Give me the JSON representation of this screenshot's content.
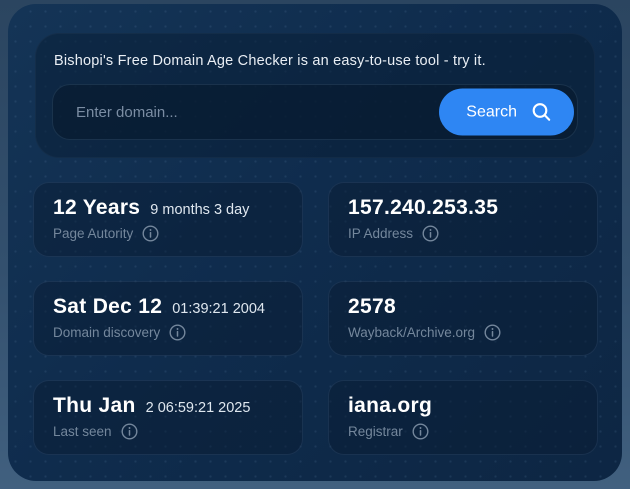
{
  "search": {
    "heading": "Bishopi's Free Domain Age Checker is an easy-to-use tool - try it.",
    "placeholder": "Enter domain...",
    "input_value": "",
    "button_label": "Search"
  },
  "cards": [
    {
      "value": "12 Years",
      "value_secondary": "9 months 3 day",
      "label": "Page Autority"
    },
    {
      "value": "157.240.253.35",
      "value_secondary": "",
      "label": "IP Address"
    },
    {
      "value": "Sat Dec 12",
      "value_secondary": "01:39:21 2004",
      "label": "Domain discovery"
    },
    {
      "value": "2578",
      "value_secondary": "",
      "label": "Wayback/Archive.org"
    },
    {
      "value": "Thu Jan",
      "value_secondary": "2 06:59:21 2025",
      "label": "Last seen"
    },
    {
      "value": "iana.org",
      "value_secondary": "",
      "label": "Registrar"
    }
  ],
  "colors": {
    "accent_blue": "#2e86f3",
    "panel_navy": "#0f2c4d",
    "card_navy": "#0c2441",
    "muted_label": "#74879c",
    "outer_background": "#33506e"
  },
  "icons": {
    "search_button_icon": "magnifier-icon",
    "card_label_icon": "info-circle-icon"
  }
}
